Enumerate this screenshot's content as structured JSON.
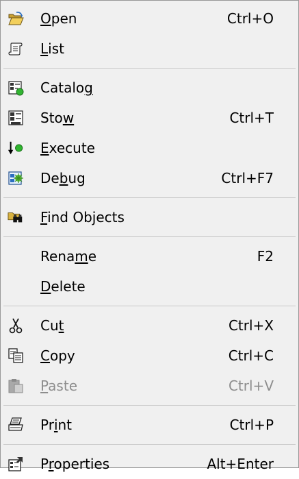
{
  "menu": {
    "items": [
      {
        "id": "open",
        "icon": "open-folder-icon",
        "label_before": "",
        "mnemonic": "O",
        "label_after": "pen",
        "shortcut": "Ctrl+O",
        "enabled": true
      },
      {
        "id": "list",
        "icon": "list-scroll-icon",
        "label_before": "",
        "mnemonic": "L",
        "label_after": "ist",
        "shortcut": "",
        "enabled": true
      },
      {
        "id": "catalog",
        "icon": "catalog-icon",
        "label_before": "Catalo",
        "mnemonic": "g",
        "label_after": "",
        "shortcut": "",
        "enabled": true
      },
      {
        "id": "stow",
        "icon": "stow-icon",
        "label_before": "Sto",
        "mnemonic": "w",
        "label_after": "",
        "shortcut": "Ctrl+T",
        "enabled": true
      },
      {
        "id": "execute",
        "icon": "execute-icon",
        "label_before": "",
        "mnemonic": "E",
        "label_after": "xecute",
        "shortcut": "",
        "enabled": true
      },
      {
        "id": "debug",
        "icon": "debug-icon",
        "label_before": "De",
        "mnemonic": "b",
        "label_after": "ug",
        "shortcut": "Ctrl+F7",
        "enabled": true
      },
      {
        "id": "find-objects",
        "icon": "find-objects-icon",
        "label_before": "",
        "mnemonic": "F",
        "label_after": "ind Objects",
        "shortcut": "",
        "enabled": true
      },
      {
        "id": "rename",
        "icon": "",
        "label_before": "Rena",
        "mnemonic": "m",
        "label_after": "e",
        "shortcut": "F2",
        "enabled": true
      },
      {
        "id": "delete",
        "icon": "",
        "label_before": "",
        "mnemonic": "D",
        "label_after": "elete",
        "shortcut": "",
        "enabled": true
      },
      {
        "id": "cut",
        "icon": "scissors-icon",
        "label_before": "Cu",
        "mnemonic": "t",
        "label_after": "",
        "shortcut": "Ctrl+X",
        "enabled": true
      },
      {
        "id": "copy",
        "icon": "copy-icon",
        "label_before": "",
        "mnemonic": "C",
        "label_after": "opy",
        "shortcut": "Ctrl+C",
        "enabled": true
      },
      {
        "id": "paste",
        "icon": "paste-icon",
        "label_before": "",
        "mnemonic": "P",
        "label_after": "aste",
        "shortcut": "Ctrl+V",
        "enabled": false
      },
      {
        "id": "print",
        "icon": "printer-icon",
        "label_before": "Pr",
        "mnemonic": "i",
        "label_after": "nt",
        "shortcut": "Ctrl+P",
        "enabled": true
      },
      {
        "id": "properties",
        "icon": "properties-icon",
        "label_before": "P",
        "mnemonic": "r",
        "label_after": "operties",
        "shortcut": "Alt+Enter",
        "enabled": true
      }
    ]
  },
  "colors": {
    "menu_background": "#f0f0f0",
    "separator": "#c8c8c8",
    "disabled_text": "#8d8d8d",
    "border": "#979797"
  }
}
